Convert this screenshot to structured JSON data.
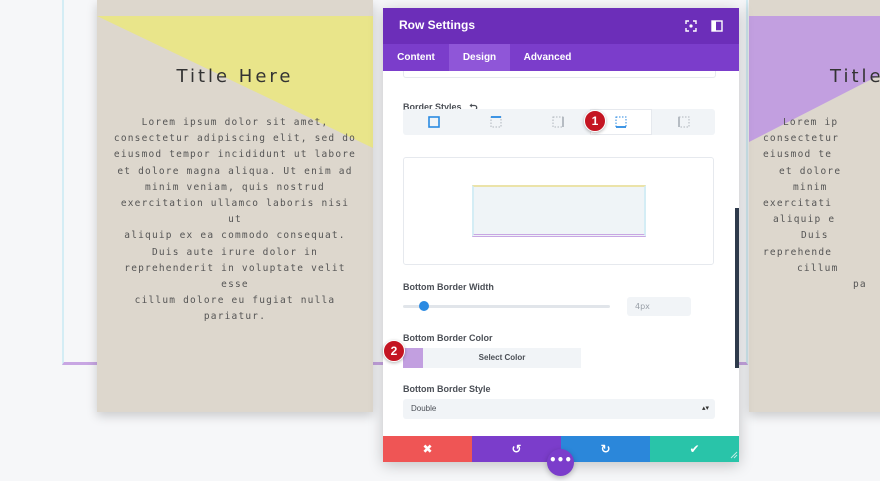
{
  "cards": {
    "left": {
      "title": "Title Here",
      "body_lines": [
        "Lorem ipsum dolor sit amet,",
        "consectetur adipiscing elit, sed do",
        "eiusmod tempor incididunt ut labore",
        "et dolore magna aliqua. Ut enim ad",
        "minim veniam, quis nostrud",
        "exercitation ullamco laboris nisi ut",
        "aliquip ex ea commodo consequat.",
        "Duis aute irure dolor in",
        "reprehenderit in voluptate velit esse",
        "cillum dolore eu fugiat nulla",
        "pariatur."
      ],
      "accent_color": "#e9e58a"
    },
    "right": {
      "title": "Title",
      "body_lines": [
        "Lorem ip",
        "consectetur",
        "eiusmod te",
        "et dolore",
        "minim",
        "exercitati",
        "aliquip e",
        "Duis",
        "reprehende",
        "cillum",
        "pa"
      ],
      "accent_color": "#c29fe0"
    }
  },
  "modal": {
    "title": "Row Settings",
    "header_icons": [
      "focus-icon",
      "sidebar-toggle-icon"
    ],
    "tabs": [
      {
        "label": "Content",
        "active": false
      },
      {
        "label": "Design",
        "active": true
      },
      {
        "label": "Advanced",
        "active": false
      }
    ],
    "border_styles": {
      "label": "Border Styles",
      "reset_icon": "undo-icon",
      "options": [
        "all-borders",
        "top-border",
        "right-border",
        "bottom-border",
        "left-border"
      ],
      "active_option": "bottom-border"
    },
    "bottom_border_width": {
      "label": "Bottom Border Width",
      "value": "4px",
      "slider_fraction": 0.1
    },
    "bottom_border_color": {
      "label": "Bottom Border Color",
      "button_label": "Select Color",
      "swatch_color": "#c29fe0"
    },
    "bottom_border_style": {
      "label": "Bottom Border Style",
      "value": "Double"
    },
    "footer_buttons": [
      {
        "name": "discard",
        "icon": "✖",
        "color": "#ef5555"
      },
      {
        "name": "undo",
        "icon": "↺",
        "color": "#7b3dcb"
      },
      {
        "name": "redo",
        "icon": "↻",
        "color": "#2b87da"
      },
      {
        "name": "save",
        "icon": "✔",
        "color": "#29c4a9"
      }
    ]
  },
  "more_button": {
    "icon": "•••"
  },
  "badges": [
    "1",
    "2"
  ]
}
